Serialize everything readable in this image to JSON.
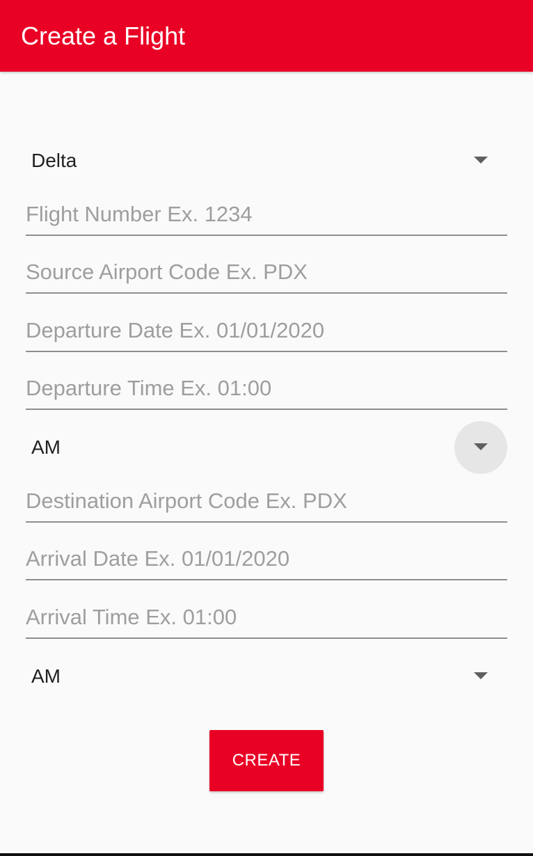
{
  "app_bar": {
    "title": "Create a Flight",
    "color": "#e90025"
  },
  "form": {
    "airline_spinner": {
      "selected": "Delta",
      "icon": "dropdown-arrow-icon"
    },
    "flight_number": {
      "value": "",
      "placeholder": "Flight Number Ex. 1234"
    },
    "source_airport": {
      "value": "",
      "placeholder": "Source Airport Code Ex. PDX"
    },
    "departure_date": {
      "value": "",
      "placeholder": "Departure Date Ex. 01/01/2020"
    },
    "departure_time": {
      "value": "",
      "placeholder": "Departure Time Ex. 01:00"
    },
    "departure_ampm_spinner": {
      "selected": "AM",
      "icon": "dropdown-arrow-icon"
    },
    "destination_airport": {
      "value": "",
      "placeholder": "Destination Airport Code Ex. PDX"
    },
    "arrival_date": {
      "value": "",
      "placeholder": "Arrival Date Ex. 01/01/2020"
    },
    "arrival_time": {
      "value": "",
      "placeholder": "Arrival Time Ex. 01:00"
    },
    "arrival_ampm_spinner": {
      "selected": "AM",
      "icon": "dropdown-arrow-icon"
    },
    "create_button": {
      "label": "CREATE",
      "color": "#e90025"
    }
  }
}
